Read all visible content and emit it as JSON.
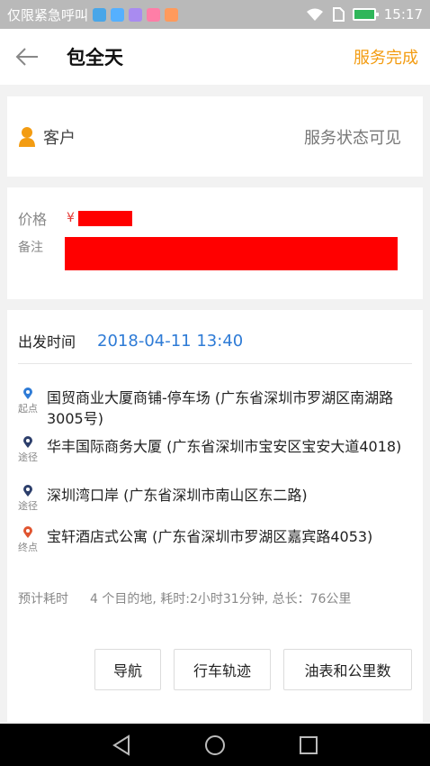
{
  "status_bar": {
    "left_text": "仅限紧急呼叫",
    "time": "15:17",
    "app_icon_colors": [
      "#49a6e8",
      "#55b0ff",
      "#a98bf0",
      "#ff7ea7",
      "#ff9a5c"
    ]
  },
  "header": {
    "title": "包全天",
    "status": "服务完成"
  },
  "customer": {
    "label": "客户",
    "service_status": "服务状态可见"
  },
  "price": {
    "label": "价格",
    "currency": "¥",
    "note_label": "备注"
  },
  "trip": {
    "depart_label": "出发时间",
    "depart_time": "2018-04-11 13:40",
    "stops": [
      {
        "tag": "起点",
        "marker_color": "#2e7bd6",
        "address": "国贸商业大厦商铺-停车场 (广东省深圳市罗湖区南湖路3005号)"
      },
      {
        "tag": "途径",
        "marker_color": "#2c3e6b",
        "address": "华丰国际商务大厦 (广东省深圳市宝安区宝安大道4018)"
      },
      {
        "tag": "途径",
        "marker_color": "#2c3e6b",
        "address": "深圳湾口岸 (广东省深圳市南山区东二路)"
      },
      {
        "tag": "终点",
        "marker_color": "#e0542f",
        "address": "宝轩酒店式公寓 (广东省深圳市罗湖区嘉宾路4053)"
      }
    ],
    "estimate_label": "预计耗时",
    "estimate_value": "4 个目的地, 耗时:2小时31分钟, 总长：76公里"
  },
  "actions": {
    "navigate": "导航",
    "track": "行车轨迹",
    "odometer": "油表和公里数"
  },
  "colors": {
    "accent_orange": "#f39c12",
    "link_blue": "#2e7bd6",
    "redaction": "#ff0000"
  }
}
